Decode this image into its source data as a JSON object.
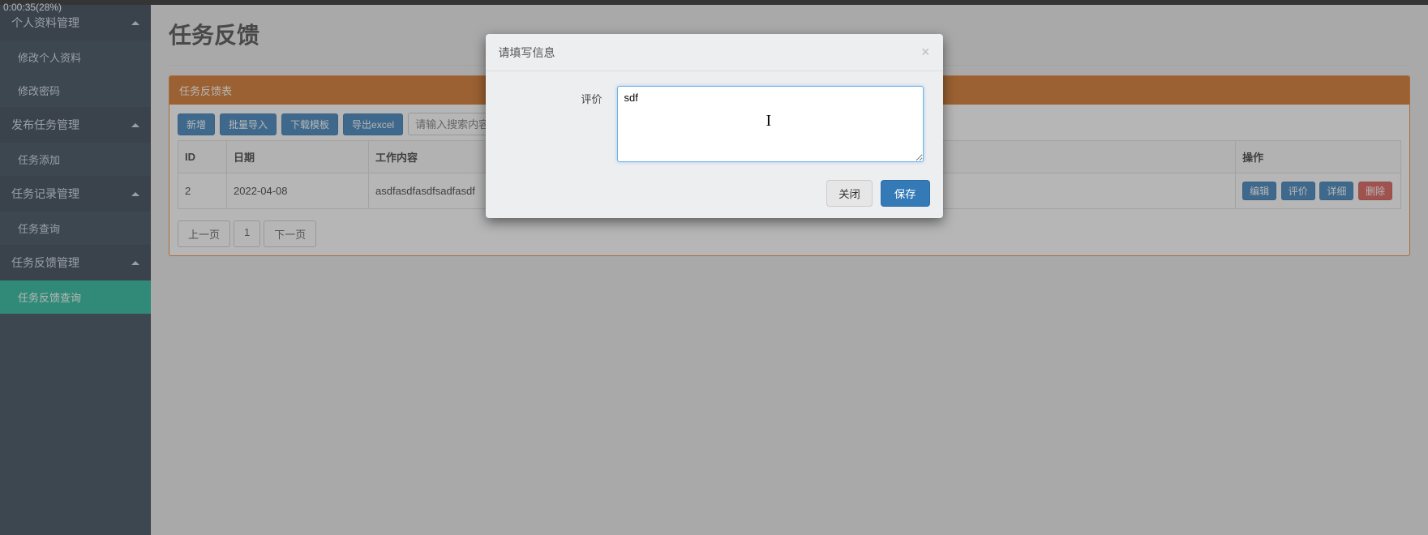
{
  "topinfo": "0:00:35(28%)",
  "sidebar": {
    "groups": [
      {
        "label": "个人资料管理",
        "items": [
          "修改个人资料",
          "修改密码"
        ]
      },
      {
        "label": "发布任务管理",
        "items": [
          "任务添加"
        ]
      },
      {
        "label": "任务记录管理",
        "items": [
          "任务查询"
        ]
      },
      {
        "label": "任务反馈管理",
        "items": [
          "任务反馈查询"
        ]
      }
    ],
    "active_item": "任务反馈查询"
  },
  "page": {
    "title": "任务反馈",
    "panel_header": "任务反馈表"
  },
  "toolbar": {
    "add": "新增",
    "batch_import": "批量导入",
    "download_template": "下载模板",
    "export_excel": "导出excel",
    "search_placeholder": "请输入搜索内容"
  },
  "table": {
    "headers": {
      "id": "ID",
      "date": "日期",
      "content": "工作内容",
      "ops": "操作"
    },
    "rows": [
      {
        "id": "2",
        "date": "2022-04-08",
        "content": "asdfasdfasdfsadfasdf"
      }
    ],
    "ops": {
      "edit": "编辑",
      "review": "评价",
      "detail": "详细",
      "delete": "删除"
    }
  },
  "pager": {
    "prev": "上一页",
    "page": "1",
    "next": "下一页"
  },
  "modal": {
    "title": "请填写信息",
    "field_label": "评价",
    "field_value": "sdf",
    "close": "关闭",
    "save": "保存"
  }
}
